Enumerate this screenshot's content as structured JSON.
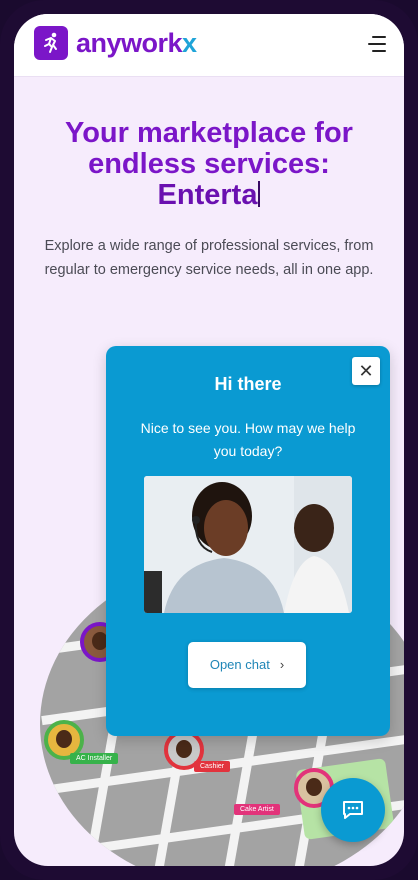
{
  "brand": {
    "name_main": "anywork",
    "name_accent": "x"
  },
  "hero": {
    "title_line1": "Your marketplace for",
    "title_line2": "endless services:",
    "title_typed": "Enterta",
    "subtitle": "Explore a wide range of professional services, from regular to emergency service needs, all in one app."
  },
  "map": {
    "tags": [
      "AC Installer",
      "Cashier",
      "Cake Artist"
    ]
  },
  "chat": {
    "title": "Hi there",
    "message": "Nice to see you. How may we help you today?",
    "open_label": "Open chat",
    "close_glyph": "✕",
    "chevron": "›"
  },
  "colors": {
    "brand_purple": "#7b16c8",
    "chat_blue": "#0a9ad2",
    "background": "#f6ecfc"
  },
  "icons": [
    "runner-logo-icon",
    "menu-icon",
    "close-icon",
    "chevron-right-icon",
    "chat-bubble-icon"
  ]
}
